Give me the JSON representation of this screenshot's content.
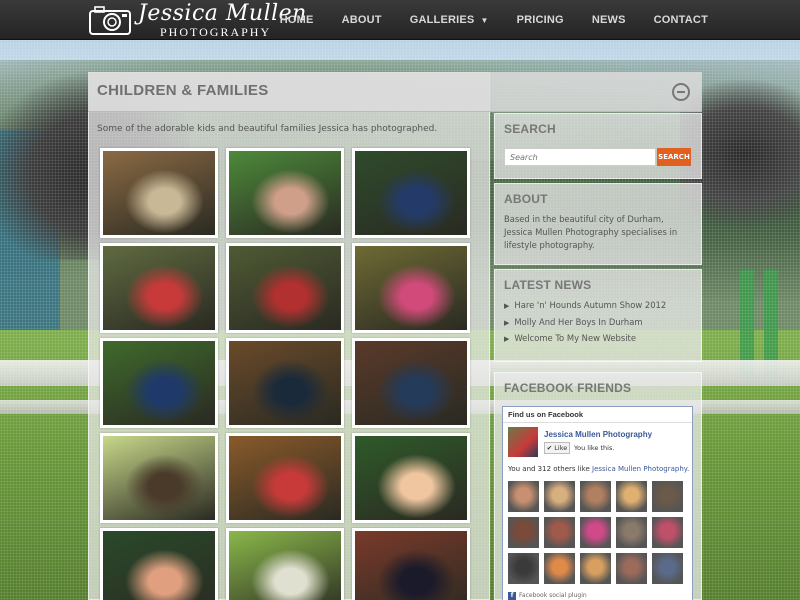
{
  "header": {
    "logo_name": "Jessica Mullen",
    "logo_sub": "PHOTOGRAPHY",
    "nav": [
      {
        "label": "HOME"
      },
      {
        "label": "ABOUT"
      },
      {
        "label": "GALLERIES",
        "has_dropdown": true
      },
      {
        "label": "PRICING"
      },
      {
        "label": "NEWS"
      },
      {
        "label": "CONTACT"
      }
    ]
  },
  "main": {
    "title": "CHILDREN & FAMILIES",
    "intro": "Some of the adorable kids and beautiful families Jessica has photographed."
  },
  "gallery": {
    "photos": [
      {
        "colors": [
          "#8b6a44",
          "#c8b896"
        ],
        "alt": "bench"
      },
      {
        "colors": [
          "#4d8a3a",
          "#cf9f8a"
        ],
        "alt": "boy glasses"
      },
      {
        "colors": [
          "#2f4b2c",
          "#243b6a"
        ],
        "alt": "boy tree"
      },
      {
        "colors": [
          "#5f6a40",
          "#c83a3a"
        ],
        "alt": "family"
      },
      {
        "colors": [
          "#4f5a34",
          "#b23030"
        ],
        "alt": "walk path"
      },
      {
        "colors": [
          "#6e6a34",
          "#d24a7a"
        ],
        "alt": "girl tree"
      },
      {
        "colors": [
          "#3f6a2c",
          "#1f3a6a"
        ],
        "alt": "two boys"
      },
      {
        "colors": [
          "#6a4a2a",
          "#1a2a3a"
        ],
        "alt": "siblings"
      },
      {
        "colors": [
          "#5a3a2a",
          "#243b5a"
        ],
        "alt": "boy swing"
      },
      {
        "colors": [
          "#c8d88a",
          "#4a3a2a"
        ],
        "alt": "couple tree"
      },
      {
        "colors": [
          "#8a5a2a",
          "#c83a3a"
        ],
        "alt": "family autumn"
      },
      {
        "colors": [
          "#2f5a2a",
          "#f0c6a0"
        ],
        "alt": "girl toy"
      },
      {
        "colors": [
          "#2a4a2a",
          "#e0a080"
        ],
        "alt": "mother baby"
      },
      {
        "colors": [
          "#8ab84a",
          "#e0e0d0"
        ],
        "alt": "baby grass"
      },
      {
        "colors": [
          "#7a3a2a",
          "#1a1a2a"
        ],
        "alt": "family leaves"
      }
    ]
  },
  "sidebar": {
    "search": {
      "title": "SEARCH",
      "placeholder": "Search",
      "button": "SEARCH"
    },
    "about": {
      "title": "ABOUT",
      "text": "Based in the beautiful city of Durham, Jessica Mullen Photography specialises in lifestyle photography."
    },
    "news": {
      "title": "LATEST NEWS",
      "items": [
        {
          "label": "Hare 'n' Hounds Autumn Show 2012"
        },
        {
          "label": "Molly And Her Boys In Durham"
        },
        {
          "label": "Welcome To My New Website"
        }
      ]
    },
    "facebook": {
      "title": "FACEBOOK FRIENDS",
      "box_title": "Find us on Facebook",
      "page_name": "Jessica Mullen Photography",
      "like_button": "Like",
      "you_like": "You like this.",
      "count_prefix": "You and 312 others like",
      "count_link": "Jessica Mullen Photography",
      "count_suffix": ".",
      "plugin": "Facebook social plugin",
      "faces": [
        "#c89070",
        "#d8b080",
        "#b08060",
        "#e0b070",
        "#6a5a4a",
        "#7a4a3a",
        "#a05a4a",
        "#d04a8a",
        "#8a7a6a",
        "#c0506a",
        "#3a3a3a",
        "#e08a4a",
        "#d8a060",
        "#9a6a5a",
        "#5a6a8a"
      ]
    }
  }
}
